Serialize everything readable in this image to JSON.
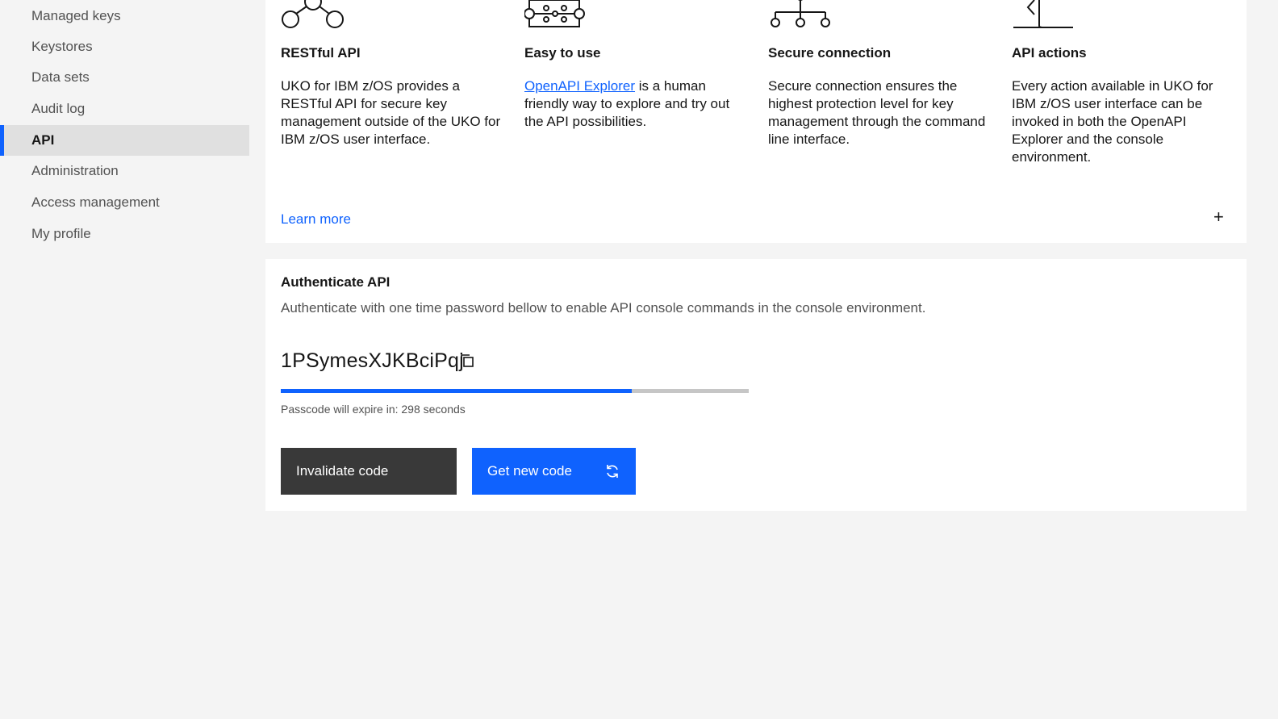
{
  "sidebar": {
    "items": [
      {
        "label": "Managed keys"
      },
      {
        "label": "Keystores"
      },
      {
        "label": "Data sets"
      },
      {
        "label": "Audit log"
      },
      {
        "label": "API",
        "active": true
      },
      {
        "label": "Administration"
      },
      {
        "label": "Access management"
      },
      {
        "label": "My profile"
      }
    ]
  },
  "features": [
    {
      "icon": "network-nodes-icon",
      "title": "RESTful API",
      "text": "UKO for IBM z/OS provides a RESTful API for secure key management outside of the UKO for IBM z/OS user interface."
    },
    {
      "icon": "circuit-icon",
      "title": "Easy to use",
      "link": "OpenAPI Explorer",
      "text": " is a human friendly way to explore and try out the API possibilities."
    },
    {
      "icon": "hierarchy-icon",
      "title": "Secure connection",
      "text": "Secure connection ensures the highest protection level for key management through the command line interface."
    },
    {
      "icon": "api-actions-icon",
      "title": "API actions",
      "text": "Every action available in UKO for IBM z/OS user interface can be invoked in both the OpenAPI Explorer and the console environment."
    }
  ],
  "learn_more": {
    "label": "Learn more",
    "expand": "+"
  },
  "auth": {
    "title": "Authenticate API",
    "description": "Authenticate with one time password bellow to enable API console commands in the console environment.",
    "passcode": "1PSymesXJKBciPqj",
    "progress_fraction": 0.75,
    "expire_text": "Passcode will expire in: 298 seconds",
    "invalidate_label": "Invalidate code",
    "new_code_label": "Get new code"
  },
  "colors": {
    "accent": "#0f62fe",
    "dark_button": "#393939",
    "background": "#f4f4f4"
  }
}
